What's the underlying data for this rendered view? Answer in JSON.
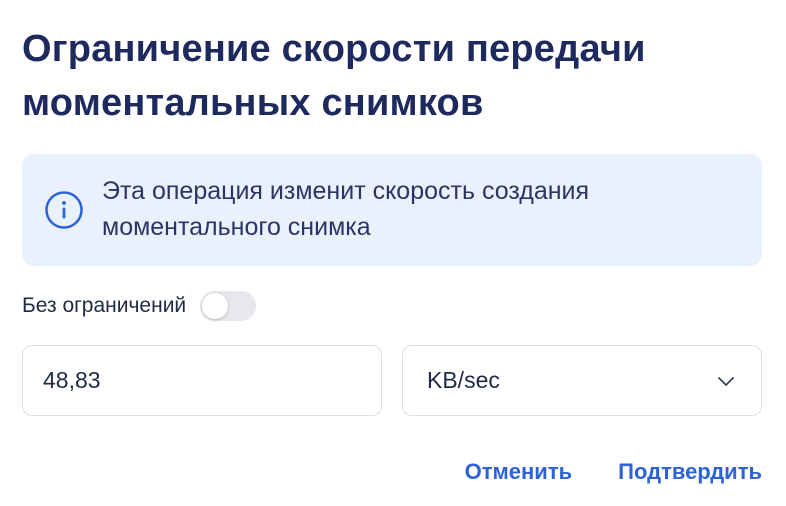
{
  "dialog": {
    "title": "Ограничение скорости передачи моментальных снимков",
    "info": {
      "icon": "info-icon",
      "text": "Эта операция изменит скорость создания моментального снимка"
    },
    "unlimited": {
      "label": "Без ограничений",
      "enabled": false
    },
    "rate": {
      "value": "48,83"
    },
    "unit": {
      "selected": "KB/sec",
      "icon": "chevron-down-icon"
    },
    "actions": {
      "cancel_label": "Отменить",
      "confirm_label": "Подтвердить"
    }
  },
  "colors": {
    "title": "#1e2a5e",
    "info_background": "#e9f1fd",
    "info_icon": "#2d63d6",
    "accent": "#2d63d6",
    "toggle_off": "#e6e8ee",
    "field_border": "#dcdfe6"
  }
}
